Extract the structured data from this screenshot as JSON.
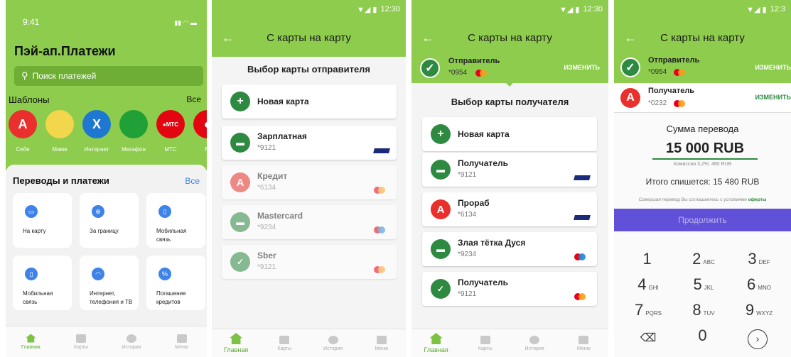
{
  "colors": {
    "green": "#8dcc4d",
    "accent": "#2e8a41",
    "purple": "#6150d8",
    "blue": "#3f83e8"
  },
  "status": {
    "time": "9:41",
    "clock": "12:30",
    "clock_short": "12:3"
  },
  "s1": {
    "title": "Пэй-ап.Платежи",
    "search_placeholder": "Поиск платежей",
    "templates_title": "Шаблоны",
    "templates_all": "Все",
    "templates": [
      {
        "label": "Себе",
        "icon": "А"
      },
      {
        "label": "Маме",
        "icon": ""
      },
      {
        "label": "Интернет",
        "icon": "Х"
      },
      {
        "label": "Мегафон",
        "icon": ""
      },
      {
        "label": "МТС",
        "icon": "●МТС"
      },
      {
        "label": "М",
        "icon": "●"
      }
    ],
    "transfers_title": "Переводы и платежи",
    "transfers_all": "Все",
    "tiles": [
      {
        "label": "На карту",
        "icon": "card-icon"
      },
      {
        "label": "За границу",
        "icon": "globe-icon"
      },
      {
        "label": "Мобильная связь",
        "icon": "phone-icon"
      },
      {
        "label": "Мобильная связь",
        "icon": "phone-icon"
      },
      {
        "label": "Интернет, телефония и ТВ",
        "icon": "wifi-icon"
      },
      {
        "label": "Погашение кредитов",
        "icon": "percent-icon"
      }
    ]
  },
  "tabs": [
    "Главная",
    "Карты",
    "История",
    "Меню"
  ],
  "s2": {
    "header": "С карты на карту",
    "section": "Выбор карты отправителя",
    "new_card": "Новая карта",
    "cards": [
      {
        "name": "Зарплатная",
        "num": "*9121",
        "brand": "visa"
      },
      {
        "name": "Кредит",
        "num": "*6134",
        "brand": "mastercard"
      },
      {
        "name": "Mastercard",
        "num": "*9234",
        "brand": "maestro"
      },
      {
        "name": "Sber",
        "num": "*9121",
        "brand": "mastercard"
      }
    ]
  },
  "s3": {
    "header": "С карты на карту",
    "sender_label": "Отправитель",
    "sender_num": "*0954",
    "change": "ИЗМЕНИТЬ",
    "section": "Выбор карты получателя",
    "new_card": "Новая карта",
    "cards": [
      {
        "name": "Получатель",
        "num": "*9121",
        "brand": "visa"
      },
      {
        "name": "Прораб",
        "num": "*6134",
        "brand": "visa"
      },
      {
        "name": "Злая тётка Дуся",
        "num": "*9234",
        "brand": "maestro"
      },
      {
        "name": "Получатель",
        "num": "*9121",
        "brand": "mastercard"
      }
    ]
  },
  "s4": {
    "header": "С карты на карту",
    "sender_label": "Отправитель",
    "sender_num": "*0954",
    "recipient_label": "Получатель",
    "recipient_num": "*0232",
    "change": "ИЗМЕНИТЬ",
    "amount_title": "Сумма перевода",
    "amount": "15 000 RUB",
    "commission": "Комиссия 3,2%: 480 RUB",
    "total": "Итого спишется: 15 480 RUB",
    "terms": "Совершая перевод Вы соглашаетесь с условиями",
    "terms_link": "оферты",
    "continue": "Продолжить",
    "keys": [
      {
        "d": "1",
        "l": ""
      },
      {
        "d": "2",
        "l": "ABC"
      },
      {
        "d": "3",
        "l": "DEF"
      },
      {
        "d": "4",
        "l": "GHI"
      },
      {
        "d": "5",
        "l": "JKL"
      },
      {
        "d": "6",
        "l": "MNO"
      },
      {
        "d": "7",
        "l": "PQRS"
      },
      {
        "d": "8",
        "l": "TUV"
      },
      {
        "d": "9",
        "l": "WXYZ"
      },
      {
        "d": "",
        "l": ""
      },
      {
        "d": "0",
        "l": ""
      },
      {
        "d": "",
        "l": ""
      }
    ]
  }
}
